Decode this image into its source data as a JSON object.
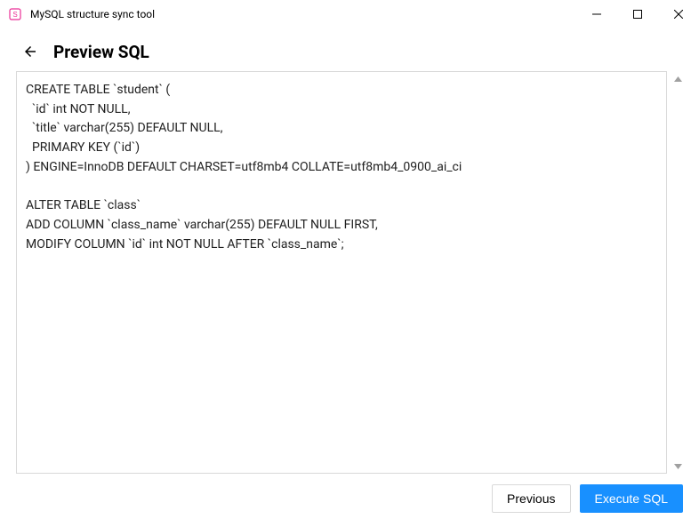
{
  "window": {
    "title": "MySQL structure sync tool"
  },
  "header": {
    "page_title": "Preview SQL"
  },
  "sql": {
    "content": "CREATE TABLE `student` (\n  `id` int NOT NULL,\n  `title` varchar(255) DEFAULT NULL,\n  PRIMARY KEY (`id`)\n) ENGINE=InnoDB DEFAULT CHARSET=utf8mb4 COLLATE=utf8mb4_0900_ai_ci\n\nALTER TABLE `class`\nADD COLUMN `class_name` varchar(255) DEFAULT NULL FIRST,\nMODIFY COLUMN `id` int NOT NULL AFTER `class_name`;"
  },
  "footer": {
    "previous_label": "Previous",
    "execute_label": "Execute SQL"
  },
  "colors": {
    "primary": "#1890ff",
    "border": "#d9d9d9",
    "icon_pink": "#eb2f96"
  }
}
